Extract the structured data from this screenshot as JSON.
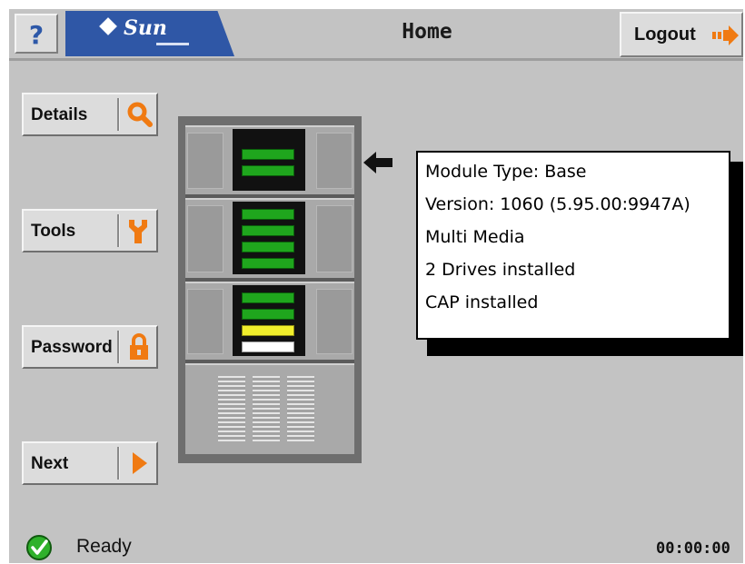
{
  "header": {
    "help_label": "?",
    "brand": "Sun",
    "title": "Home",
    "logout_label": "Logout",
    "brand_color": "#2f57a6"
  },
  "sidebar": {
    "buttons": [
      {
        "label": "Details",
        "icon": "magnifier-icon"
      },
      {
        "label": "Tools",
        "icon": "wrench-icon"
      },
      {
        "label": "Password",
        "icon": "lock-icon"
      },
      {
        "label": "Next",
        "icon": "arrow-right-icon"
      }
    ]
  },
  "library": {
    "modules": [
      {
        "leds": [
          "green",
          "green"
        ]
      },
      {
        "leds": [
          "green",
          "green",
          "green",
          "green"
        ]
      },
      {
        "leds": [
          "green",
          "green",
          "yellow",
          "white"
        ]
      },
      {
        "type": "vent"
      }
    ]
  },
  "info": {
    "lines": [
      "Module Type: Base",
      "Version: 1060 (5.95.00:9947A)",
      "Multi Media",
      "2 Drives installed",
      "CAP installed"
    ]
  },
  "status": {
    "text": "Ready",
    "icon": "check-circle-icon",
    "clock": "00:00:00"
  },
  "colors": {
    "accent_orange": "#f07a12",
    "led_green": "#1fa61d",
    "led_yellow": "#f1ee2c",
    "status_green": "#2fb12b"
  }
}
